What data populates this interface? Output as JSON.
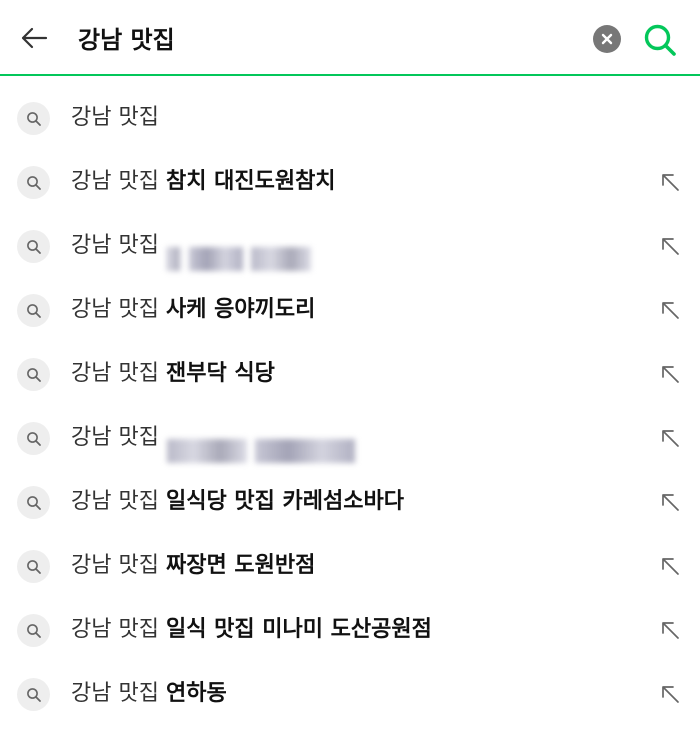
{
  "search": {
    "query": "강남 맛집",
    "accent_color": "#03c75a",
    "back_icon": "arrow-left-icon",
    "clear_icon": "clear-x-icon",
    "search_icon": "search-icon"
  },
  "suggestions": [
    {
      "prefix": "강남 맛집",
      "suffix": "",
      "blurred": false,
      "has_arrow": false
    },
    {
      "prefix": "강남 맛집",
      "suffix": "참치 대진도원참치",
      "blurred": false,
      "has_arrow": true
    },
    {
      "prefix": "강남 맛집",
      "suffix": "",
      "blurred": true,
      "has_arrow": true
    },
    {
      "prefix": "강남 맛집",
      "suffix": "사케 응야끼도리",
      "blurred": false,
      "has_arrow": true
    },
    {
      "prefix": "강남 맛집",
      "suffix": "잰부닥 식당",
      "blurred": false,
      "has_arrow": true
    },
    {
      "prefix": "강남 맛집",
      "suffix": "",
      "blurred": true,
      "has_arrow": true
    },
    {
      "prefix": "강남 맛집",
      "suffix": "일식당 맛집 카레섬소바다",
      "blurred": false,
      "has_arrow": true
    },
    {
      "prefix": "강남 맛집",
      "suffix": "짜장면 도원반점",
      "blurred": false,
      "has_arrow": true
    },
    {
      "prefix": "강남 맛집",
      "suffix": "일식 맛집 미나미 도산공원점",
      "blurred": false,
      "has_arrow": true
    },
    {
      "prefix": "강남 맛집",
      "suffix": "연하동",
      "blurred": false,
      "has_arrow": true
    }
  ],
  "suggestion_icon": "magnifier-icon",
  "fill_icon": "arrow-up-left-icon"
}
